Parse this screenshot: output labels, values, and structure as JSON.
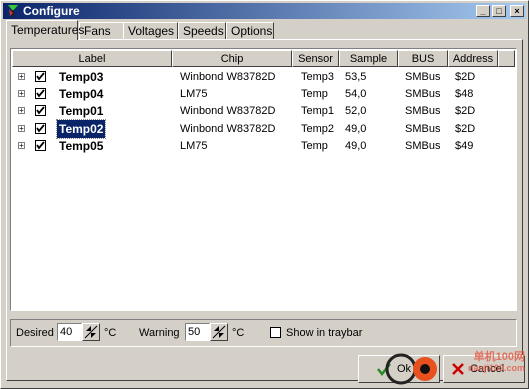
{
  "window": {
    "title": "Configure"
  },
  "tabs": [
    {
      "label": "Temperatures",
      "active": true
    },
    {
      "label": "Fans",
      "active": false
    },
    {
      "label": "Voltages",
      "active": false
    },
    {
      "label": "Speeds",
      "active": false
    },
    {
      "label": "Options",
      "active": false
    }
  ],
  "columns": [
    "Label",
    "Chip",
    "Sensor",
    "Sample",
    "BUS",
    "Address"
  ],
  "rows": [
    {
      "label": "Temp03",
      "chip": "Winbond W83782D",
      "sensor": "Temp3",
      "sample": "53,5",
      "bus": "SMBus",
      "address": "$2D",
      "checked": true,
      "selected": false
    },
    {
      "label": "Temp04",
      "chip": "LM75",
      "sensor": "Temp",
      "sample": "54,0",
      "bus": "SMBus",
      "address": "$48",
      "checked": true,
      "selected": false
    },
    {
      "label": "Temp01",
      "chip": "Winbond W83782D",
      "sensor": "Temp1",
      "sample": "52,0",
      "bus": "SMBus",
      "address": "$2D",
      "checked": true,
      "selected": false
    },
    {
      "label": "Temp02",
      "chip": "Winbond W83782D",
      "sensor": "Temp2",
      "sample": "49,0",
      "bus": "SMBus",
      "address": "$2D",
      "checked": true,
      "selected": true
    },
    {
      "label": "Temp05",
      "chip": "LM75",
      "sensor": "Temp",
      "sample": "49,0",
      "bus": "SMBus",
      "address": "$49",
      "checked": true,
      "selected": false
    }
  ],
  "settings": {
    "desired_label": "Desired",
    "desired_value": "40",
    "desired_unit": "°C",
    "warning_label": "Warning",
    "warning_value": "50",
    "warning_unit": "°C",
    "tray_label": "Show in traybar",
    "tray_checked": false
  },
  "buttons": {
    "ok": "Ok",
    "cancel": "Cancel"
  },
  "watermark": {
    "line1": "单机100网",
    "line2": "danji100.com"
  },
  "colors": {
    "title_start": "#0a246a",
    "title_end": "#a6caf0",
    "selection": "#0a246a",
    "cancel_icon": "#cc0000",
    "ok_icon": "#2a8a2a"
  }
}
